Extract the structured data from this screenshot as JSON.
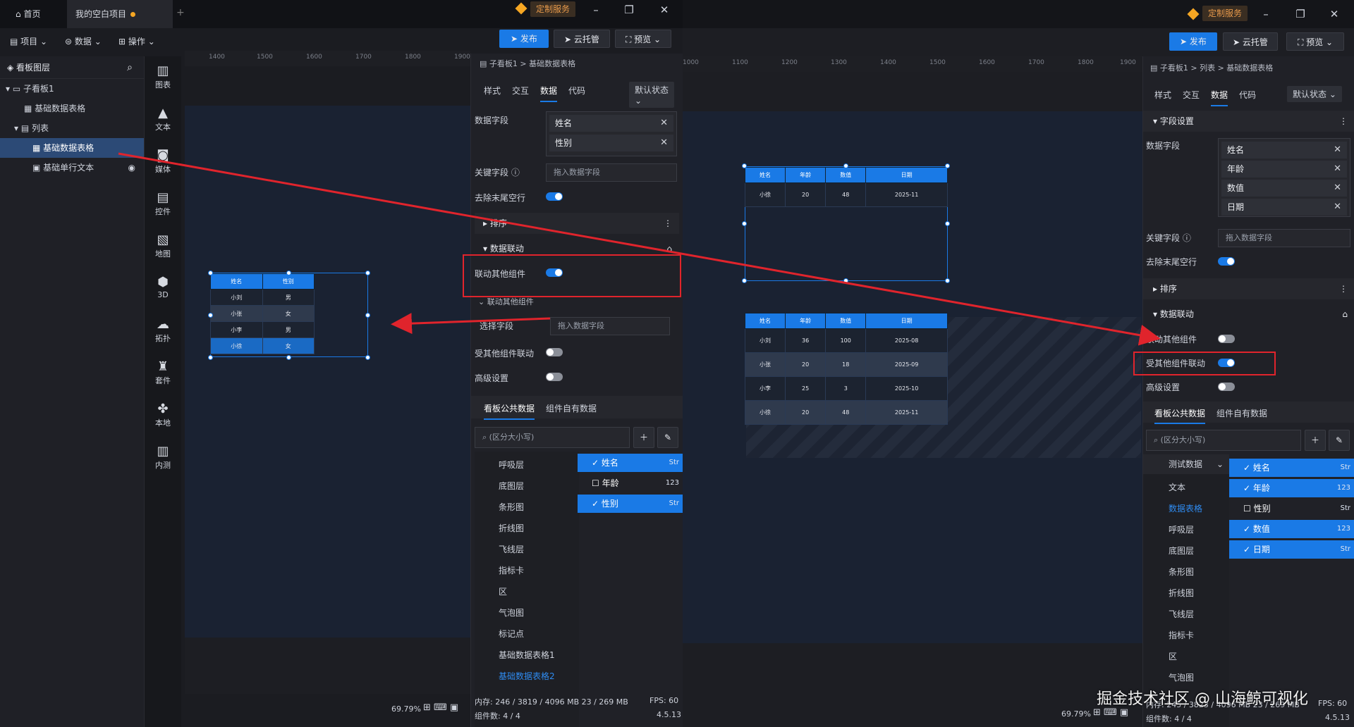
{
  "winA": {
    "tabs": {
      "home": "首页",
      "project": "我的空白项目"
    },
    "custom_service": "定制服务",
    "menu": {
      "project": "项目",
      "data": "数据",
      "operate": "操作"
    },
    "actions": {
      "publish": "发布",
      "cloud": "云托管",
      "preview": "预览"
    },
    "layers": {
      "title": "看板图层",
      "items": [
        "子看板1",
        "基础数据表格",
        "列表",
        "基础数据表格",
        "基础单行文本"
      ]
    },
    "sidebar": [
      "图表",
      "文本",
      "媒体",
      "控件",
      "地图",
      "3D",
      "拓扑",
      "套件",
      "本地",
      "内测"
    ],
    "ruler": [
      "1400",
      "1500",
      "1600",
      "1700",
      "1800",
      "1900"
    ],
    "breadcrumb": "子看板1 > 基础数据表格",
    "prop_tabs": [
      "样式",
      "交互",
      "数据",
      "代码"
    ],
    "state_select": "默认状态",
    "data_field_label": "数据字段",
    "data_fields": [
      "姓名",
      "性别"
    ],
    "key_field_label": "关键字段",
    "key_field_placeholder": "拖入数据字段",
    "trim_label": "去除末尾空行",
    "sort_label": "排序",
    "link_section": "数据联动",
    "link_other": "联动其他组件",
    "link_other_sub": "联动其他组件",
    "select_field": "选择字段",
    "select_field_placeholder": "拖入数据字段",
    "linked_by_other": "受其他组件联动",
    "advanced": "高级设置",
    "data_tabs": [
      "看板公共数据",
      "组件自有数据"
    ],
    "search_placeholder": "(区分大小写)",
    "data_list": [
      "呼吸层",
      "底图层",
      "条形图",
      "折线图",
      "飞线层",
      "指标卡",
      "区",
      "气泡图",
      "标记点",
      "基础数据表格1",
      "基础数据表格2"
    ],
    "field_options": [
      {
        "name": "姓名",
        "type": "Str",
        "checked": true
      },
      {
        "name": "年龄",
        "type": "123",
        "checked": false
      },
      {
        "name": "性别",
        "type": "Str",
        "checked": true
      }
    ],
    "status": {
      "memory": "内存: 246 / 3819 / 4096 MB  23 / 269 MB",
      "fps": "FPS: 60",
      "count": "组件数: 4 / 4",
      "version": "4.5.13",
      "zoom": "69.79%"
    },
    "table": {
      "headers": [
        "姓名",
        "性别"
      ],
      "rows": [
        [
          "小刘",
          "男"
        ],
        [
          "小张",
          "女"
        ],
        [
          "小李",
          "男"
        ],
        [
          "小徐",
          "女"
        ]
      ]
    }
  },
  "winB": {
    "custom_service": "定制服务",
    "actions": {
      "publish": "发布",
      "cloud": "云托管",
      "preview": "预览"
    },
    "ruler": [
      "1000",
      "1100",
      "1200",
      "1300",
      "1400",
      "1500",
      "1600",
      "1700",
      "1800",
      "1900"
    ],
    "breadcrumb": "子看板1 > 列表 > 基础数据表格",
    "prop_tabs": [
      "样式",
      "交互",
      "数据",
      "代码"
    ],
    "state_select": "默认状态",
    "field_section": "字段设置",
    "data_field_label": "数据字段",
    "data_fields": [
      "姓名",
      "年龄",
      "数值",
      "日期"
    ],
    "key_field_label": "关键字段",
    "key_field_placeholder": "拖入数据字段",
    "trim_label": "去除末尾空行",
    "sort_label": "排序",
    "link_section": "数据联动",
    "link_other": "联动其他组件",
    "linked_by_other": "受其他组件联动",
    "advanced": "高级设置",
    "data_tabs": [
      "看板公共数据",
      "组件自有数据"
    ],
    "search_placeholder": "(区分大小写)",
    "data_group": "测试数据",
    "data_list": [
      "文本",
      "数据表格",
      "呼吸层",
      "底图层",
      "条形图",
      "折线图",
      "飞线层",
      "指标卡",
      "区",
      "气泡图"
    ],
    "field_options": [
      {
        "name": "姓名",
        "type": "Str",
        "checked": true
      },
      {
        "name": "年龄",
        "type": "123",
        "checked": true
      },
      {
        "name": "性别",
        "type": "Str",
        "checked": false
      },
      {
        "name": "数值",
        "type": "123",
        "checked": true
      },
      {
        "name": "日期",
        "type": "Str",
        "checked": true
      }
    ],
    "status": {
      "memory": "内存: 245 / 3823 / 4096 MB  23 / 269 MB",
      "fps": "FPS: 60",
      "count": "组件数: 4 / 4",
      "version": "4.5.13",
      "zoom": "69.79%"
    },
    "table_top": {
      "headers": [
        "姓名",
        "年龄",
        "数值",
        "日期"
      ],
      "rows": [
        [
          "小徐",
          "20",
          "48",
          "2025-11"
        ]
      ]
    },
    "table_bottom": {
      "headers": [
        "姓名",
        "年龄",
        "数值",
        "日期"
      ],
      "rows": [
        [
          "小刘",
          "36",
          "100",
          "2025-08"
        ],
        [
          "小张",
          "20",
          "18",
          "2025-09"
        ],
        [
          "小李",
          "25",
          "3",
          "2025-10"
        ],
        [
          "小徐",
          "20",
          "48",
          "2025-11"
        ]
      ]
    }
  },
  "watermark": "掘金技术社区 @ 山海鲸可视化",
  "colors": {
    "accent": "#1a7ae6",
    "annotation": "#e0242c",
    "badge": "#e89a4b"
  }
}
